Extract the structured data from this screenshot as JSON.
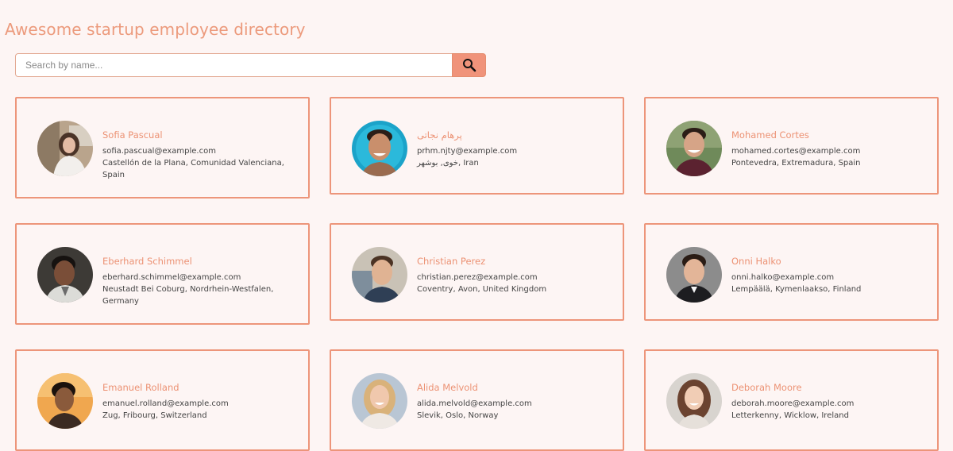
{
  "header": {
    "title": "Awesome startup employee directory"
  },
  "search": {
    "placeholder": "Search by name...",
    "value": ""
  },
  "colors": {
    "accent": "#ec9274",
    "card_border": "#ed957a",
    "background": "#fdf5f4",
    "search_button": "#f0937a"
  },
  "employees": [
    {
      "name": "Sofia Pascual",
      "email": "sofia.pascual@example.com",
      "location": "Castellón de la Plana, Comunidad Valenciana, Spain",
      "avatar": "avatar-photo"
    },
    {
      "name": "پرهام نجاتی",
      "email": "prhm.njty@example.com",
      "location": "خوی, بوشهر, Iran",
      "avatar": "avatar-photo"
    },
    {
      "name": "Mohamed Cortes",
      "email": "mohamed.cortes@example.com",
      "location": "Pontevedra, Extremadura, Spain",
      "avatar": "avatar-photo"
    },
    {
      "name": "Eberhard Schimmel",
      "email": "eberhard.schimmel@example.com",
      "location": "Neustadt Bei Coburg, Nordrhein-Westfalen, Germany",
      "avatar": "avatar-photo"
    },
    {
      "name": "Christian Perez",
      "email": "christian.perez@example.com",
      "location": "Coventry, Avon, United Kingdom",
      "avatar": "avatar-photo"
    },
    {
      "name": "Onni Halko",
      "email": "onni.halko@example.com",
      "location": "Lempäälä, Kymenlaakso, Finland",
      "avatar": "avatar-photo"
    },
    {
      "name": "Emanuel Rolland",
      "email": "emanuel.rolland@example.com",
      "location": "Zug, Fribourg, Switzerland",
      "avatar": "avatar-photo"
    },
    {
      "name": "Alida Melvold",
      "email": "alida.melvold@example.com",
      "location": "Slevik, Oslo, Norway",
      "avatar": "avatar-photo"
    },
    {
      "name": "Deborah Moore",
      "email": "deborah.moore@example.com",
      "location": "Letterkenny, Wicklow, Ireland",
      "avatar": "avatar-photo"
    }
  ]
}
